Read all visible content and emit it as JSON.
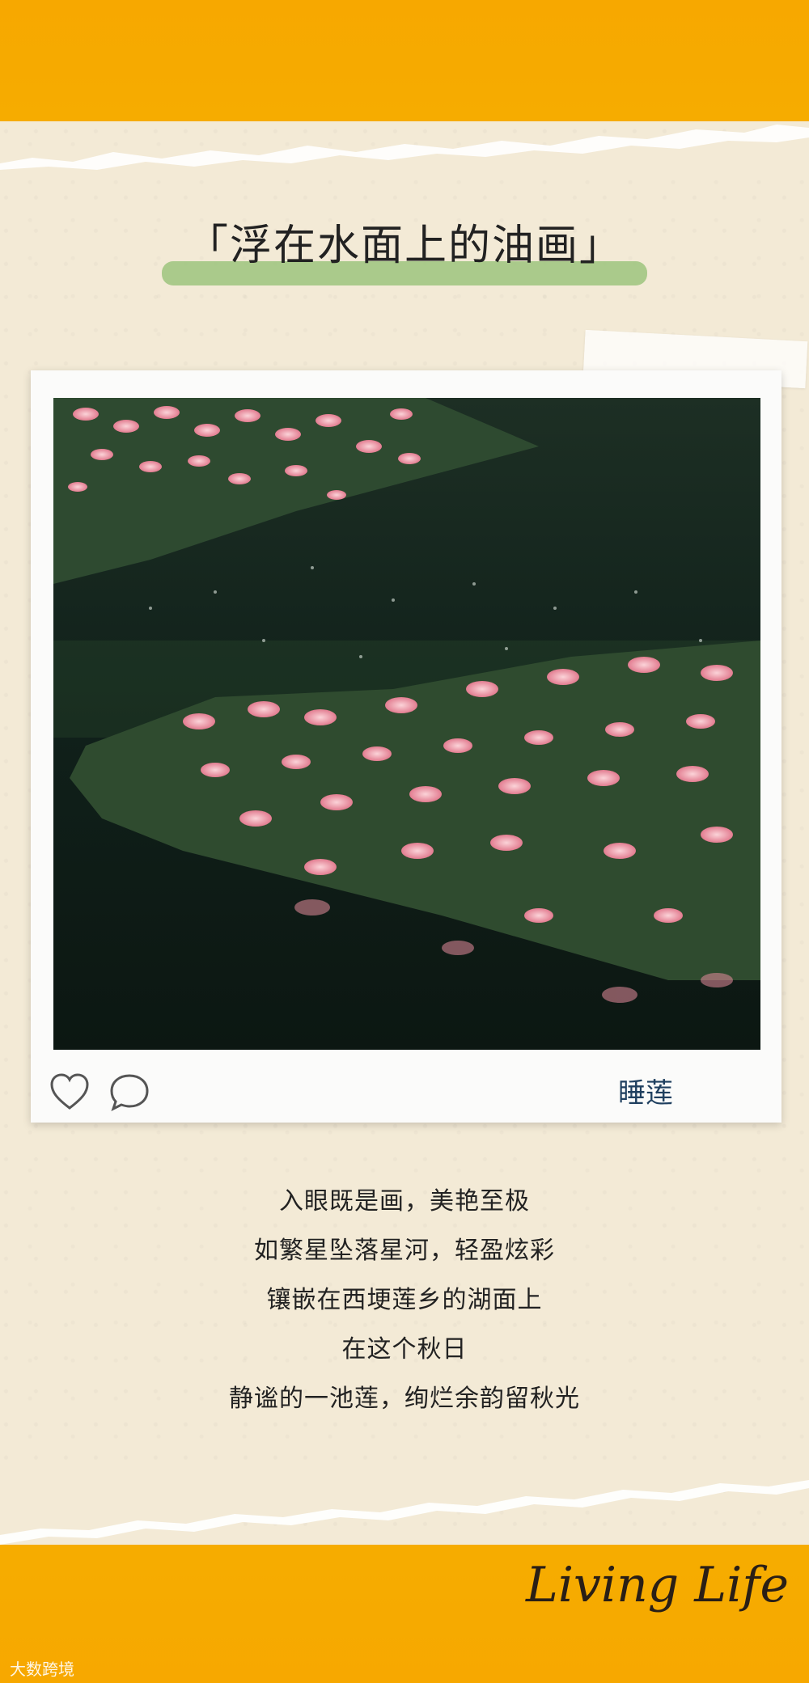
{
  "title": "「浮在水面上的油画」",
  "post": {
    "caption": "睡莲",
    "icons": [
      "heart-icon",
      "comment-icon"
    ]
  },
  "poem": [
    "入眼既是画，美艳至极",
    "如繁星坠落星河，轻盈炫彩",
    "镶嵌在西埂莲乡的湖面上",
    "在这个秋日",
    "静谧的一池莲，绚烂余韵留秋光"
  ],
  "signature": "Living Life",
  "watermark": "大数跨境",
  "colors": {
    "band": "#f6b000",
    "paper": "#f3ead6",
    "highlight": "#9cc47e",
    "caption": "#1f3f5f"
  }
}
